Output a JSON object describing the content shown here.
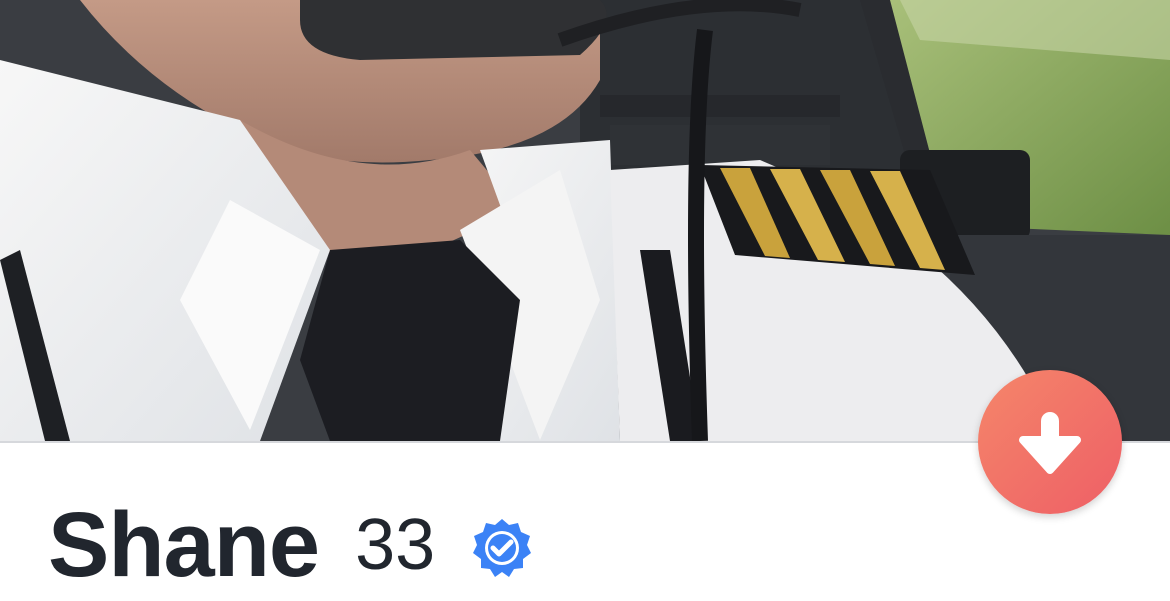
{
  "profile": {
    "name": "Shane",
    "age": "33",
    "verified": true,
    "photo": "profile-photo"
  },
  "actions": {
    "expand_icon": "arrow-down-icon"
  },
  "colors": {
    "name_text": "#21262e",
    "badge": "#3b82f6",
    "fab_start": "#f5866a",
    "fab_end": "#ee5f66"
  }
}
